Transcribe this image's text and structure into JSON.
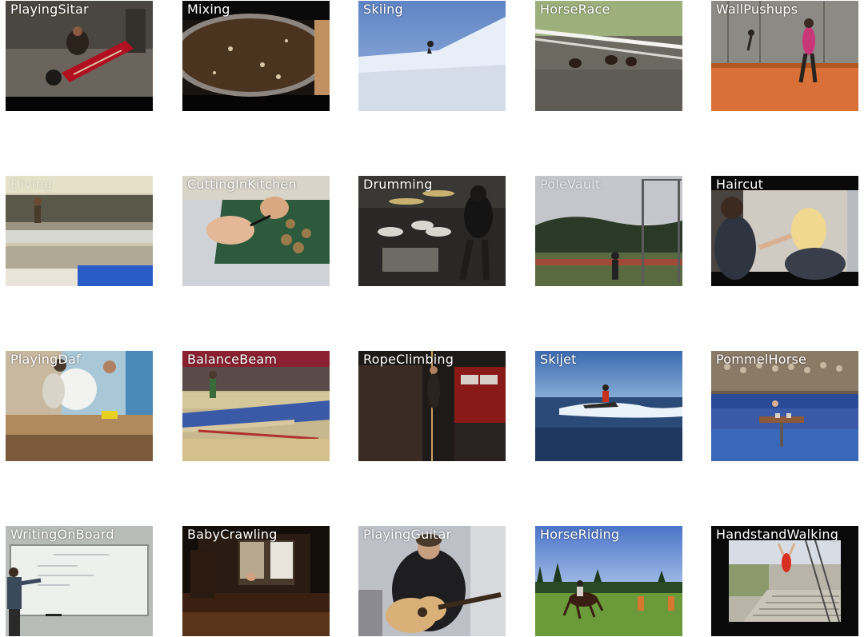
{
  "grid": {
    "tiles": [
      {
        "label": "PlayingSitar"
      },
      {
        "label": "Mixing"
      },
      {
        "label": "Skiing"
      },
      {
        "label": "HorseRace"
      },
      {
        "label": "WallPushups"
      },
      {
        "label": "Diving"
      },
      {
        "label": "CuttingInKitchen"
      },
      {
        "label": "Drumming"
      },
      {
        "label": "PoleVault"
      },
      {
        "label": "Haircut"
      },
      {
        "label": "PlayingDaf"
      },
      {
        "label": "BalanceBeam"
      },
      {
        "label": "RopeClimbing"
      },
      {
        "label": "Skijet"
      },
      {
        "label": "PommelHorse"
      },
      {
        "label": "WritingOnBoard"
      },
      {
        "label": "BabyCrawling"
      },
      {
        "label": "PlayingGuitar"
      },
      {
        "label": "HorseRiding"
      },
      {
        "label": "HandstandWalking"
      }
    ]
  }
}
